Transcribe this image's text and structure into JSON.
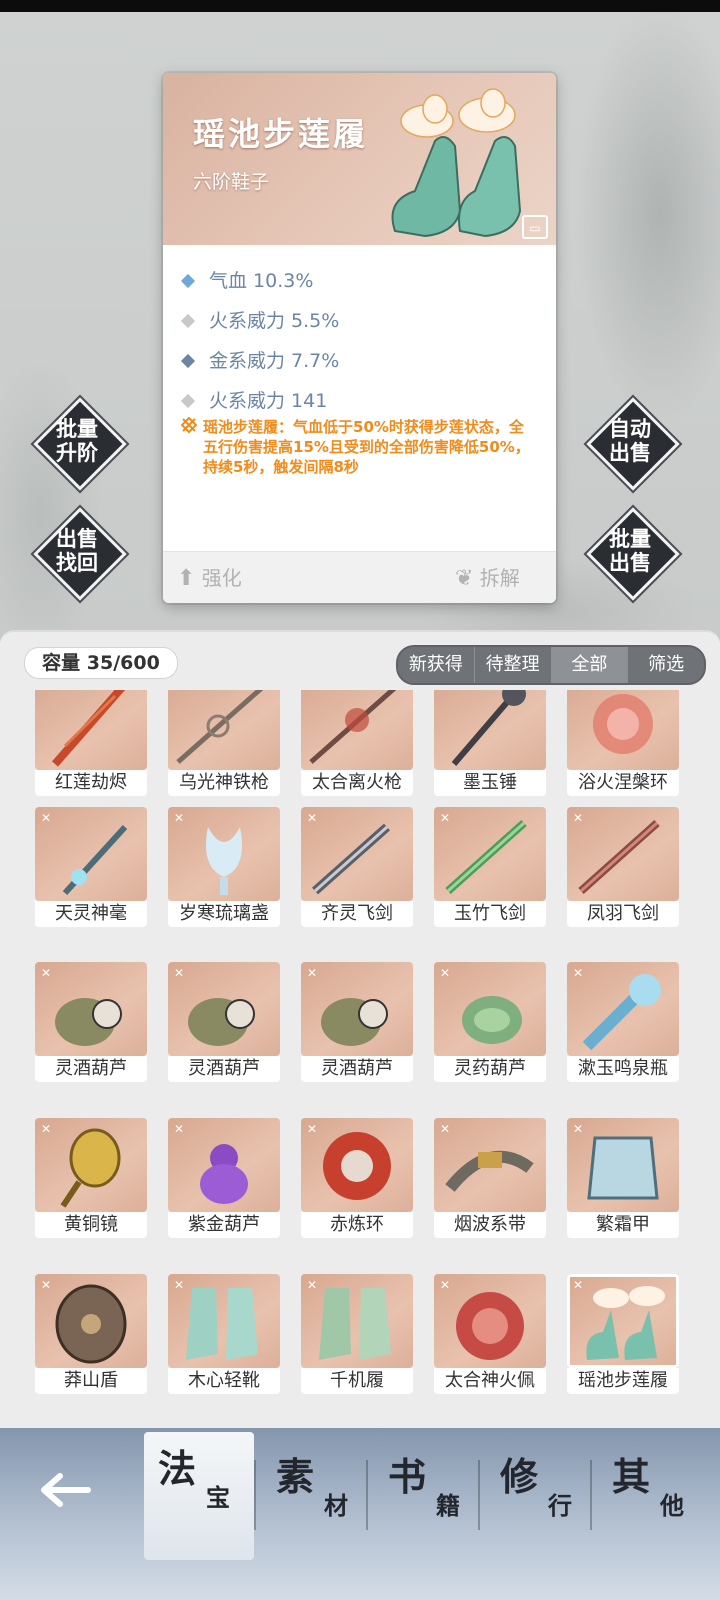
{
  "item_detail": {
    "name": "瑶池步莲履",
    "type": "六阶鞋子",
    "stats": [
      {
        "text": "气血 10.3%",
        "color": "#6fa9d6"
      },
      {
        "text": "火系威力 5.5%",
        "color": "#c8c8c8"
      },
      {
        "text": "金系威力 7.7%",
        "color": "#6c85a3"
      },
      {
        "text": "火系威力 141",
        "color": "#c8c8c8"
      }
    ],
    "skill_text": "瑶池步莲履：气血低于50%时获得步莲状态，全五行伤害提高15%且受到的全部伤害降低50%，持续5秒，触发间隔8秒",
    "enhance_label": "强化",
    "dismantle_label": "拆解"
  },
  "side_buttons": {
    "batch_upgrade": [
      "批量",
      "升阶"
    ],
    "sold_recover": [
      "出售",
      "找回"
    ],
    "auto_sell": [
      "自动",
      "出售"
    ],
    "batch_sell": [
      "批量",
      "出售"
    ]
  },
  "inventory": {
    "capacity": "容量 35/600",
    "tabs": [
      "新获得",
      "待整理",
      "全部",
      "筛选"
    ],
    "active_tab": "全部",
    "items": [
      "红莲劫烬",
      "乌光神铁枪",
      "太合离火枪",
      "墨玉锤",
      "浴火涅槃环",
      "天灵神毫",
      "岁寒琉璃盏",
      "齐灵飞剑",
      "玉竹飞剑",
      "凤羽飞剑",
      "灵酒葫芦",
      "灵酒葫芦",
      "灵酒葫芦",
      "灵药葫芦",
      "漱玉鸣泉瓶",
      "黄铜镜",
      "紫金葫芦",
      "赤炼环",
      "烟波系带",
      "繁霜甲",
      "莽山盾",
      "木心轻靴",
      "千机履",
      "太合神火佩",
      "瑶池步莲履"
    ]
  },
  "bottom_nav": [
    {
      "big": "法",
      "small": "宝"
    },
    {
      "big": "素",
      "small": "材"
    },
    {
      "big": "书",
      "small": "籍"
    },
    {
      "big": "修",
      "small": "行"
    },
    {
      "big": "其",
      "small": "他"
    }
  ],
  "active_nav": "法宝"
}
